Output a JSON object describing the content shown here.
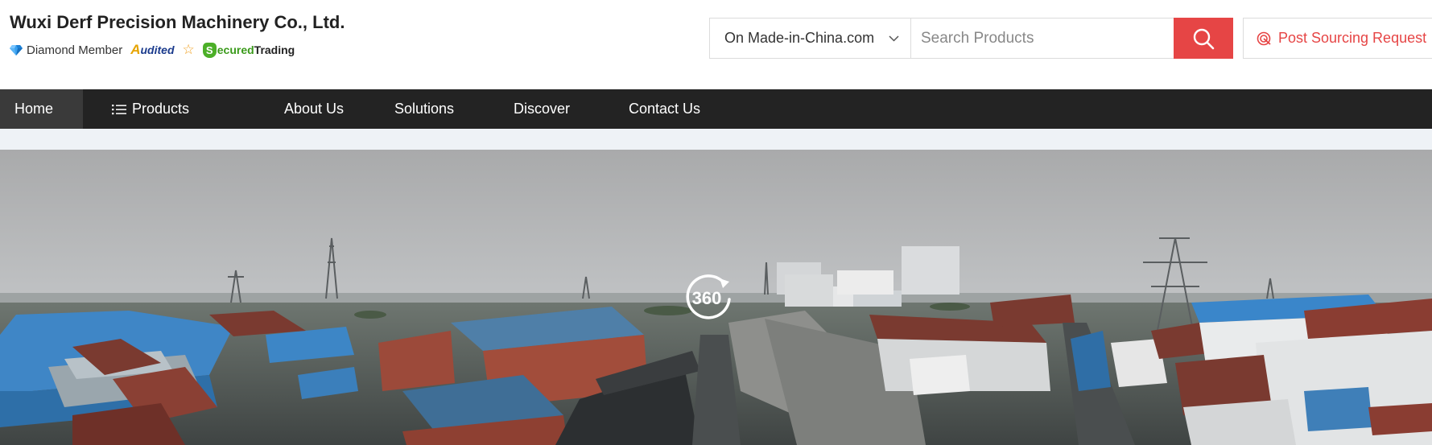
{
  "company": {
    "name": "Wuxi Derf Precision Machinery Co., Ltd.",
    "badges": {
      "diamond_member": "Diamond Member",
      "audited": "udited",
      "audited_mark": "A",
      "secured_mark": "S",
      "secured_green": "ecured",
      "secured_rest": "Trading"
    }
  },
  "search": {
    "scope": "On Made-in-China.com",
    "placeholder": "Search Products",
    "value": ""
  },
  "sourcing": {
    "label": "Post Sourcing Request"
  },
  "nav": {
    "items": [
      {
        "label": "Home",
        "active": true
      },
      {
        "label": "Products"
      },
      {
        "label": "About Us"
      },
      {
        "label": "Solutions"
      },
      {
        "label": "Discover"
      },
      {
        "label": "Contact Us"
      }
    ]
  },
  "banner": {
    "badge": "360"
  },
  "icons": {
    "diamond": "diamond-icon",
    "star": "star-icon",
    "search": "search-icon",
    "chevron": "chevron-down-icon",
    "sourcing": "target-icon",
    "list": "list-icon",
    "panorama": "panorama-360-icon"
  },
  "colors": {
    "accent": "#e64545",
    "nav_bg": "#232323",
    "nav_active": "#3a3a3a",
    "secured_green": "#3a9a1a",
    "audited_blue": "#1a3a8c"
  }
}
